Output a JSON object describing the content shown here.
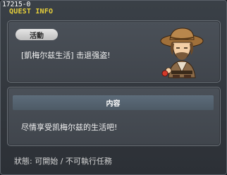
{
  "window": {
    "id": "17215-0",
    "title": "QUEST INFO"
  },
  "activity": {
    "label": "活動",
    "quest_name": "[凱梅尔兹生活] 击退强盗!"
  },
  "content": {
    "label": "内容",
    "text": "尽情享受凯梅尔兹的生活吧!"
  },
  "status": {
    "text": "狀態: 可開始 / 不可執行任務"
  },
  "npc": {
    "icon": "npc-portrait-icon"
  }
}
